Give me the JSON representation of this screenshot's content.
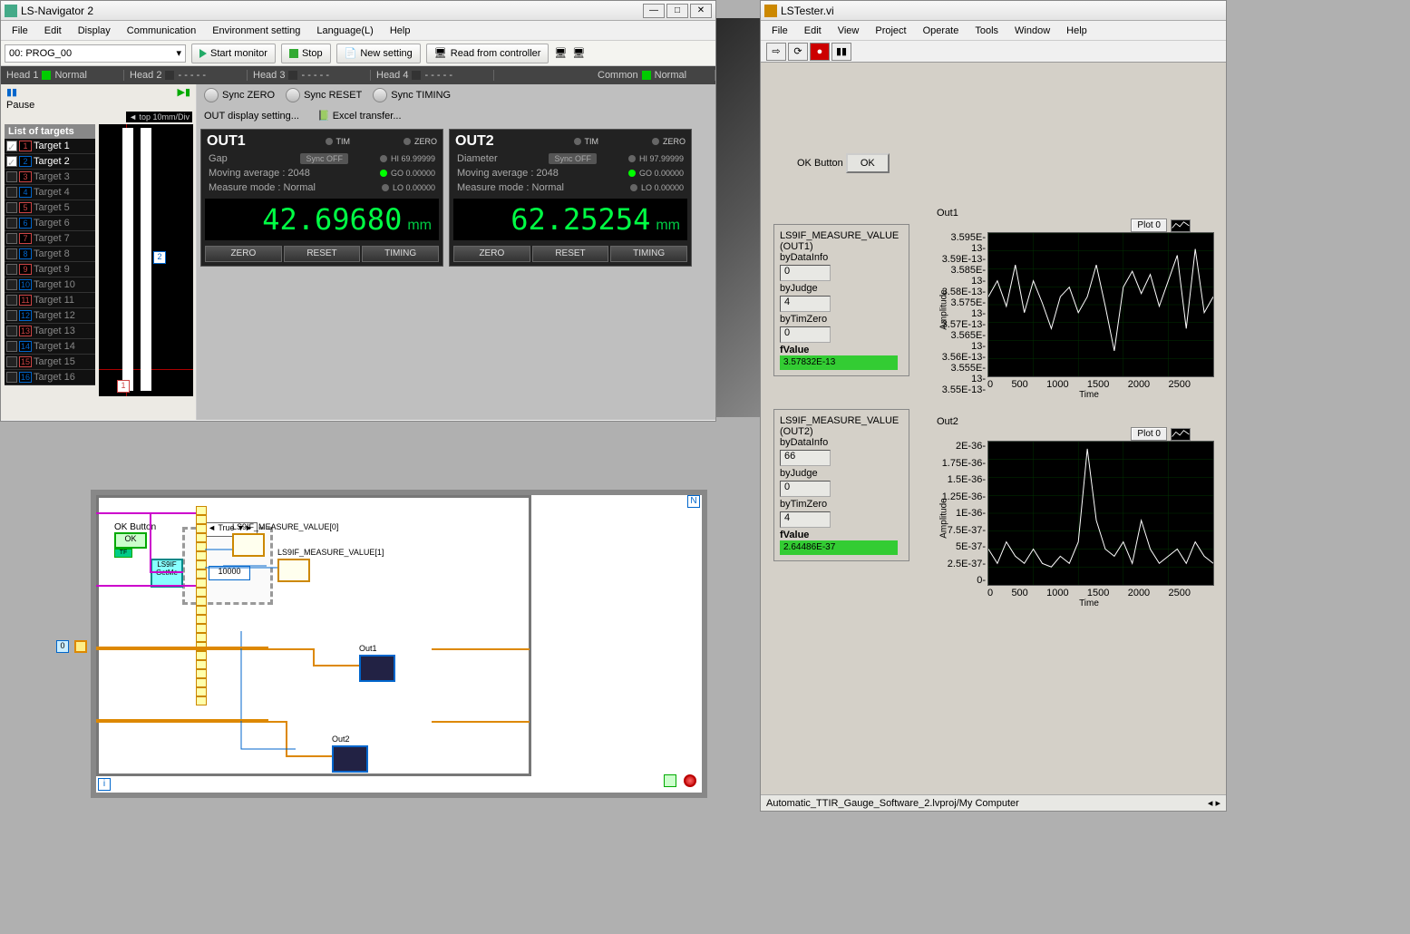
{
  "lsnav": {
    "title": "LS-Navigator 2",
    "menu": [
      "File",
      "Edit",
      "Display",
      "Communication",
      "Environment setting",
      "Language(L)",
      "Help"
    ],
    "prog": "00: PROG_00",
    "toolbar": {
      "start": "Start monitor",
      "stop": "Stop",
      "newset": "New setting",
      "read": "Read from controller"
    },
    "heads": [
      {
        "n": "Head 1",
        "st": "Normal",
        "on": true
      },
      {
        "n": "Head 2",
        "st": "- - - - -",
        "on": false
      },
      {
        "n": "Head 3",
        "st": "- - - - -",
        "on": false
      },
      {
        "n": "Head 4",
        "st": "- - - - -",
        "on": false
      }
    ],
    "common": {
      "label": "Common",
      "st": "Normal"
    },
    "pause": "Pause",
    "top": "◄ top  10mm/Div",
    "tl_head": "List of targets",
    "targets": [
      {
        "n": 1,
        "t": "Target 1",
        "c": true
      },
      {
        "n": 2,
        "t": "Target 2",
        "c": true
      },
      {
        "n": 3,
        "t": "Target 3",
        "c": false
      },
      {
        "n": 4,
        "t": "Target 4",
        "c": false
      },
      {
        "n": 5,
        "t": "Target 5",
        "c": false
      },
      {
        "n": 6,
        "t": "Target 6",
        "c": false
      },
      {
        "n": 7,
        "t": "Target 7",
        "c": false
      },
      {
        "n": 8,
        "t": "Target 8",
        "c": false
      },
      {
        "n": 9,
        "t": "Target 9",
        "c": false
      },
      {
        "n": 10,
        "t": "Target 10",
        "c": false
      },
      {
        "n": 11,
        "t": "Target 11",
        "c": false
      },
      {
        "n": 12,
        "t": "Target 12",
        "c": false
      },
      {
        "n": 13,
        "t": "Target 13",
        "c": false
      },
      {
        "n": 14,
        "t": "Target 14",
        "c": false
      },
      {
        "n": 15,
        "t": "Target 15",
        "c": false
      },
      {
        "n": 16,
        "t": "Target 16",
        "c": false
      }
    ],
    "sync": [
      "Sync ZERO",
      "Sync RESET",
      "Sync TIMING"
    ],
    "out_disp": "OUT display setting...",
    "excel": "Excel transfer...",
    "out": [
      {
        "title": "OUT1",
        "sub": "Gap",
        "avg": "Moving average :  2048",
        "mode": "Measure mode : Normal",
        "sync": "Sync OFF",
        "hi": "69.99999",
        "go": "0.00000",
        "lo": "0.00000",
        "val": "42.69680",
        "unit": "mm"
      },
      {
        "title": "OUT2",
        "sub": "Diameter",
        "avg": "Moving average :  2048",
        "mode": "Measure mode : Normal",
        "sync": "Sync OFF",
        "hi": "97.99999",
        "go": "0.00000",
        "lo": "0.00000",
        "val": "62.25254",
        "unit": "mm"
      }
    ],
    "out_btns": [
      "ZERO",
      "RESET",
      "TIMING"
    ],
    "tim": "TIM",
    "zero": "ZERO",
    "HI": "HI",
    "GO": "GO",
    "LO": "LO"
  },
  "lstester": {
    "title": "LSTester.vi",
    "menu": [
      "File",
      "Edit",
      "View",
      "Project",
      "Operate",
      "Tools",
      "Window",
      "Help"
    ],
    "ok_label": "OK Button",
    "ok": "OK",
    "clusters": [
      {
        "name": "LS9IF_MEASURE_VALUE (OUT1)",
        "byDataInfo": "0",
        "byJudge": "4",
        "byTimZero": "0",
        "fValue": "3.57832E-13"
      },
      {
        "name": "LS9IF_MEASURE_VALUE (OUT2)",
        "byDataInfo": "66",
        "byJudge": "0",
        "byTimZero": "4",
        "fValue": "2.64486E-37"
      }
    ],
    "labels": {
      "byDataInfo": "byDataInfo",
      "byJudge": "byJudge",
      "byTimZero": "byTimZero",
      "fValue": "fValue"
    },
    "plots": [
      {
        "title": "Out1",
        "legend": "Plot 0",
        "ylabel": "Amplitude",
        "xlabel": "Time",
        "xticks": [
          "0",
          "500",
          "1000",
          "1500",
          "2000",
          "2500"
        ],
        "yticks": [
          "3.595E-13",
          "3.59E-13",
          "3.585E-13",
          "3.58E-13",
          "3.575E-13",
          "3.57E-13",
          "3.565E-13",
          "3.56E-13",
          "3.555E-13",
          "3.55E-13"
        ]
      },
      {
        "title": "Out2",
        "legend": "Plot 0",
        "ylabel": "Amplitude",
        "xlabel": "Time",
        "xticks": [
          "0",
          "500",
          "1000",
          "1500",
          "2000",
          "2500"
        ],
        "yticks": [
          "2E-36",
          "1.75E-36",
          "1.5E-36",
          "1.25E-36",
          "1E-36",
          "7.5E-37",
          "5E-37",
          "2.5E-37",
          "0"
        ]
      }
    ],
    "status": "Automatic_TTIR_Gauge_Software_2.lvproj/My Computer"
  },
  "bd": {
    "ok": "OK Button",
    "okbtn": "OK",
    "true": "◄ True ▼►",
    "n10000": "10000",
    "mv0": "LS9IF_MEASURE_VALUE[0]",
    "mv1": "LS9IF_MEASURE_VALUE[1]",
    "out1": "Out1",
    "out2": "Out2",
    "zero": "0"
  },
  "chart_data": [
    {
      "type": "line",
      "title": "Out1",
      "xlabel": "Time",
      "ylabel": "Amplitude",
      "xlim": [
        0,
        2500
      ],
      "ylim": [
        3.55e-13,
        3.595e-13
      ],
      "x": [
        0,
        100,
        200,
        300,
        400,
        500,
        600,
        700,
        800,
        900,
        1000,
        1100,
        1200,
        1300,
        1400,
        1500,
        1600,
        1700,
        1800,
        1900,
        2000,
        2100,
        2200,
        2300,
        2400,
        2500
      ],
      "values": [
        3.575e-13,
        3.58e-13,
        3.572e-13,
        3.585e-13,
        3.57e-13,
        3.58e-13,
        3.573e-13,
        3.565e-13,
        3.575e-13,
        3.578e-13,
        3.57e-13,
        3.575e-13,
        3.585e-13,
        3.572e-13,
        3.558e-13,
        3.578e-13,
        3.583e-13,
        3.576e-13,
        3.582e-13,
        3.572e-13,
        3.58e-13,
        3.588e-13,
        3.565e-13,
        3.59e-13,
        3.57e-13,
        3.575e-13
      ]
    },
    {
      "type": "line",
      "title": "Out2",
      "xlabel": "Time",
      "ylabel": "Amplitude",
      "xlim": [
        0,
        2500
      ],
      "ylim": [
        0,
        2e-36
      ],
      "x": [
        0,
        100,
        200,
        300,
        400,
        500,
        600,
        700,
        800,
        900,
        1000,
        1100,
        1200,
        1300,
        1400,
        1500,
        1600,
        1700,
        1800,
        1900,
        2000,
        2100,
        2200,
        2300,
        2400,
        2500
      ],
      "values": [
        5e-37,
        3e-37,
        6e-37,
        4e-37,
        3e-37,
        5e-37,
        3e-37,
        2.5e-37,
        4e-37,
        3e-37,
        6e-37,
        1.9e-36,
        9e-37,
        5e-37,
        4e-37,
        6e-37,
        3e-37,
        9e-37,
        5e-37,
        3e-37,
        4e-37,
        5e-37,
        3e-37,
        6e-37,
        4e-37,
        3e-37
      ]
    }
  ]
}
